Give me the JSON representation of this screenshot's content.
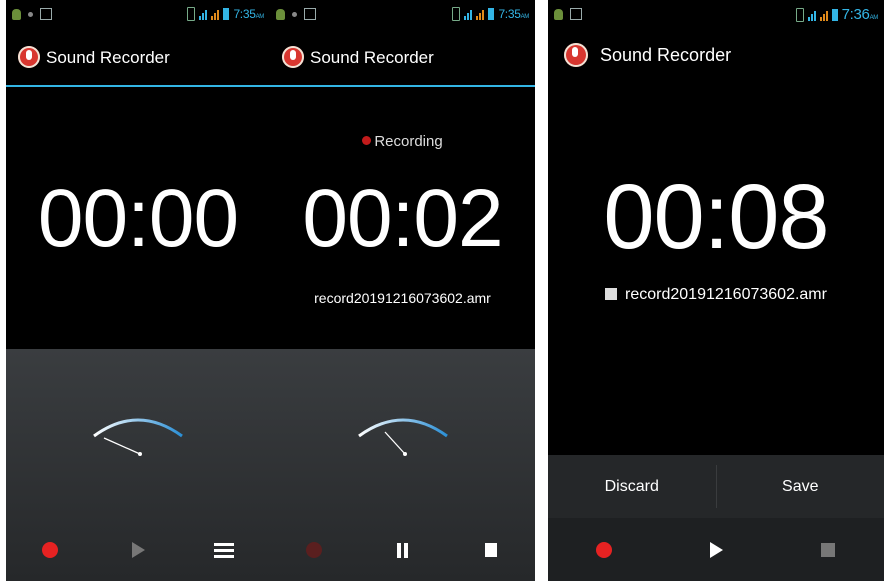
{
  "colors": {
    "accent": "#33b5e5",
    "record": "#e62222",
    "background": "#000000"
  },
  "screens": [
    {
      "status_time": "7:35",
      "status_ampm": "AM",
      "app_title": "Sound Recorder",
      "timer": "00:00",
      "controls": [
        "record-icon",
        "play-icon",
        "list-icon"
      ]
    },
    {
      "status_time": "7:35",
      "status_ampm": "AM",
      "app_title": "Sound Recorder",
      "status_label": "Recording",
      "timer": "00:02",
      "filename": "record20191216073602.amr",
      "controls": [
        "record-icon",
        "pause-icon",
        "stop-icon"
      ]
    },
    {
      "status_time": "7:36",
      "status_ampm": "AM",
      "app_title": "Sound Recorder",
      "timer": "00:08",
      "filename": "record20191216073602.amr",
      "discard_label": "Discard",
      "save_label": "Save",
      "controls": [
        "record-icon",
        "play-icon",
        "stop-icon"
      ]
    }
  ]
}
